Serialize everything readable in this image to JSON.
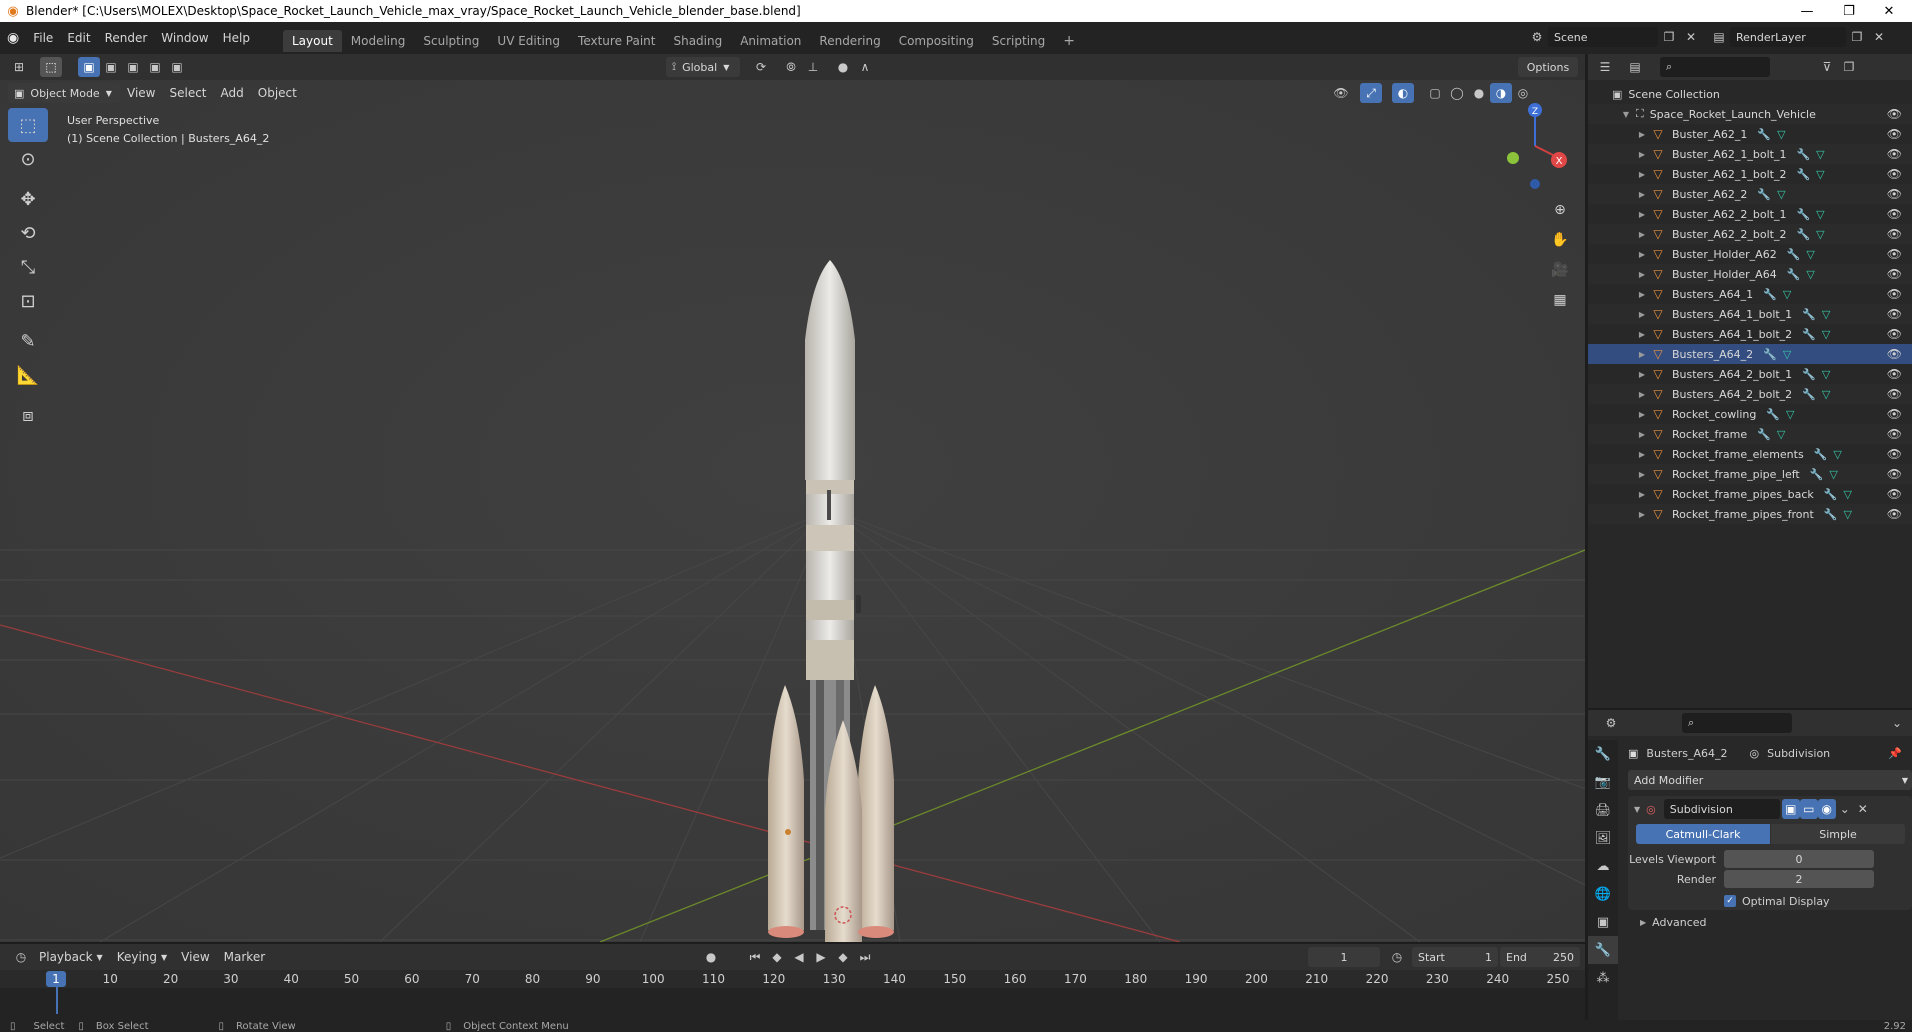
{
  "window": {
    "title": "Blender* [C:\\Users\\MOLEX\\Desktop\\Space_Rocket_Launch_Vehicle_max_vray/Space_Rocket_Launch_Vehicle_blender_base.blend]"
  },
  "menu": [
    "File",
    "Edit",
    "Render",
    "Window",
    "Help"
  ],
  "workspaces": [
    "Layout",
    "Modeling",
    "Sculpting",
    "UV Editing",
    "Texture Paint",
    "Shading",
    "Animation",
    "Rendering",
    "Compositing",
    "Scripting"
  ],
  "scene_field": "Scene",
  "renderlayer_field": "RenderLayer",
  "viewport_header": {
    "transform_orientation": "Global",
    "options": "Options",
    "mode": "Object Mode",
    "menus": [
      "View",
      "Select",
      "Add",
      "Object"
    ]
  },
  "viewport_overlay": {
    "line1": "User Perspective",
    "line2": "(1) Scene Collection | Busters_A64_2"
  },
  "gizmo": {
    "z": "Z",
    "x": "X"
  },
  "outliner": {
    "root": "Scene Collection",
    "collection": "Space_Rocket_Launch_Vehicle",
    "selected": "Busters_A64_2",
    "items": [
      "Buster_A62_1",
      "Buster_A62_1_bolt_1",
      "Buster_A62_1_bolt_2",
      "Buster_A62_2",
      "Buster_A62_2_bolt_1",
      "Buster_A62_2_bolt_2",
      "Buster_Holder_A62",
      "Buster_Holder_A64",
      "Busters_A64_1",
      "Busters_A64_1_bolt_1",
      "Busters_A64_1_bolt_2",
      "Busters_A64_2",
      "Busters_A64_2_bolt_1",
      "Busters_A64_2_bolt_2",
      "Rocket_cowling",
      "Rocket_frame",
      "Rocket_frame_elements",
      "Rocket_frame_pipe_left",
      "Rocket_frame_pipes_back",
      "Rocket_frame_pipes_front"
    ]
  },
  "properties": {
    "object_name": "Busters_A64_2",
    "modifier_tab": "Subdivision",
    "add_modifier": "Add Modifier",
    "modifier_name": "Subdivision",
    "mode_catmull": "Catmull-Clark",
    "mode_simple": "Simple",
    "levels_label": "Levels Viewport",
    "levels_value": "0",
    "render_label": "Render",
    "render_value": "2",
    "optimal_display": "Optimal Display",
    "advanced": "Advanced"
  },
  "timeline": {
    "menus": [
      "Playback",
      "Keying",
      "View",
      "Marker"
    ],
    "current_frame": "1",
    "start_label": "Start",
    "start_value": "1",
    "end_label": "End",
    "end_value": "250",
    "ruler": [
      "1",
      "10",
      "20",
      "30",
      "40",
      "50",
      "60",
      "70",
      "80",
      "90",
      "100",
      "110",
      "120",
      "130",
      "140",
      "150",
      "160",
      "170",
      "180",
      "190",
      "200",
      "210",
      "220",
      "230",
      "240",
      "250"
    ]
  },
  "statusbar": {
    "select": "Select",
    "box_select": "Box Select",
    "rotate_view": "Rotate View",
    "context_menu": "Object Context Menu",
    "version": "2.92"
  }
}
